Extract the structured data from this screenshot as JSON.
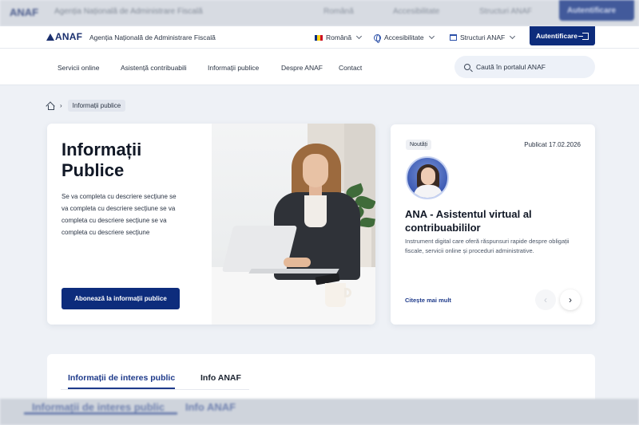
{
  "ghost_top": {
    "logo": "ANAF",
    "agency": "Agenția Națională de Administrare Fiscală",
    "language": "Română",
    "accessibility": "Accesibilitate",
    "structures": "Structuri ANAF",
    "login": "Autentificare"
  },
  "header": {
    "logo": "ANAF",
    "agency": "Agenția Națională de Administrare Fiscală",
    "language": "Română",
    "accessibility": "Accesibilitate",
    "structures": "Structuri ANAF",
    "login": "Autentificare",
    "flag_colors": [
      "#002b7f",
      "#fcd116",
      "#ce1126"
    ]
  },
  "nav": {
    "items": [
      "Servicii online",
      "Asistență contribuabili",
      "Informații publice",
      "Despre ANAF",
      "Contact"
    ],
    "search_placeholder": "Caută în portalul ANAF"
  },
  "breadcrumb": {
    "current": "Informații publice"
  },
  "hero": {
    "title": "Informații Publice",
    "description": "Se va completa cu descriere secțiune se va completa cu descriere secțiune se va completa cu descriere secțiune se va completa cu descriere secțiune",
    "button": "Abonează la informații publice"
  },
  "news": {
    "badge": "Noutăți",
    "published": "Publicat 17.02.2026",
    "title": "ANA - Asistentul virtual al contribuabililor",
    "description": "Instrument digital care oferă răspunsuri rapide despre obligații fiscale, servicii online și proceduri administrative.",
    "read_more": "Citește mai mult",
    "prev": "‹",
    "next": "›"
  },
  "tabs": [
    "Informații de interes public",
    "Info ANAF"
  ],
  "ghost_bottom": {
    "tab1": "Informații de interes public",
    "tab2": "Info ANAF"
  },
  "colors": {
    "brand": "#0d2c7c",
    "accent": "#1e3a8a",
    "background": "#eef1f6"
  }
}
